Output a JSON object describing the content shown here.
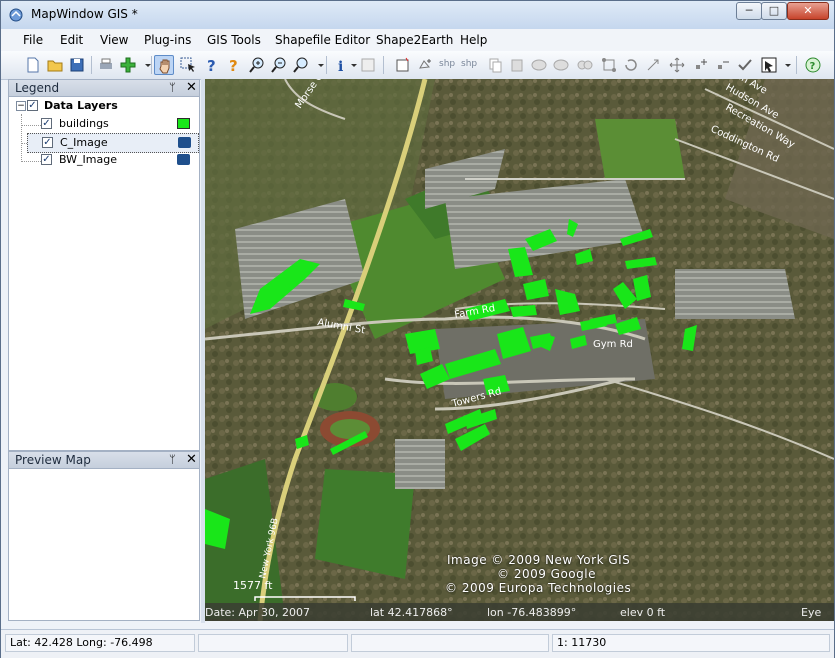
{
  "window": {
    "title": "MapWindow GIS *",
    "min": "─",
    "max": "□",
    "close": "✕"
  },
  "menu": [
    "File",
    "Edit",
    "View",
    "Plug-ins",
    "GIS Tools",
    "Shapefile Editor",
    "Shape2Earth",
    "Help"
  ],
  "toolbar": {
    "shp1": "shp",
    "shp2": "shp"
  },
  "legend": {
    "title": "Legend",
    "pin": "ᛘ",
    "close": "✕",
    "group": {
      "label": "Data Layers",
      "expanded": "−",
      "checked": "✓"
    },
    "layers": [
      {
        "label": "buildings",
        "checked": "✓",
        "swatch_color": "#19e619"
      },
      {
        "label": "C_Image",
        "checked": "✓"
      },
      {
        "label": "BW_Image",
        "checked": "✓"
      }
    ]
  },
  "preview": {
    "title": "Preview Map",
    "pin": "ᛘ",
    "close": "✕"
  },
  "map": {
    "roads": [
      "Morse Ct",
      "Alumni St",
      "Farm Rd",
      "Gym Rd",
      "Towers Rd",
      "New York 96B",
      "Coddington Rd",
      "Recreation Way",
      "Hudson Ave",
      "Penn Ave"
    ],
    "attribution": [
      "Image © 2009 New York GIS",
      "© 2009 Google",
      "© 2009 Europa Technologies"
    ],
    "scale_label": "1577 ft",
    "footer": {
      "date": "Date: Apr 30, 2007",
      "lat": "lat  42.417868°",
      "lon": "lon  -76.483899°",
      "elev": "elev    0 ft",
      "eye": "Eye"
    }
  },
  "status": {
    "coords": "Lat: 42.428 Long: -76.498",
    "scale": "1: 11730"
  },
  "colors": {
    "buildings": "#19e619",
    "road": "#d9cf7a"
  }
}
